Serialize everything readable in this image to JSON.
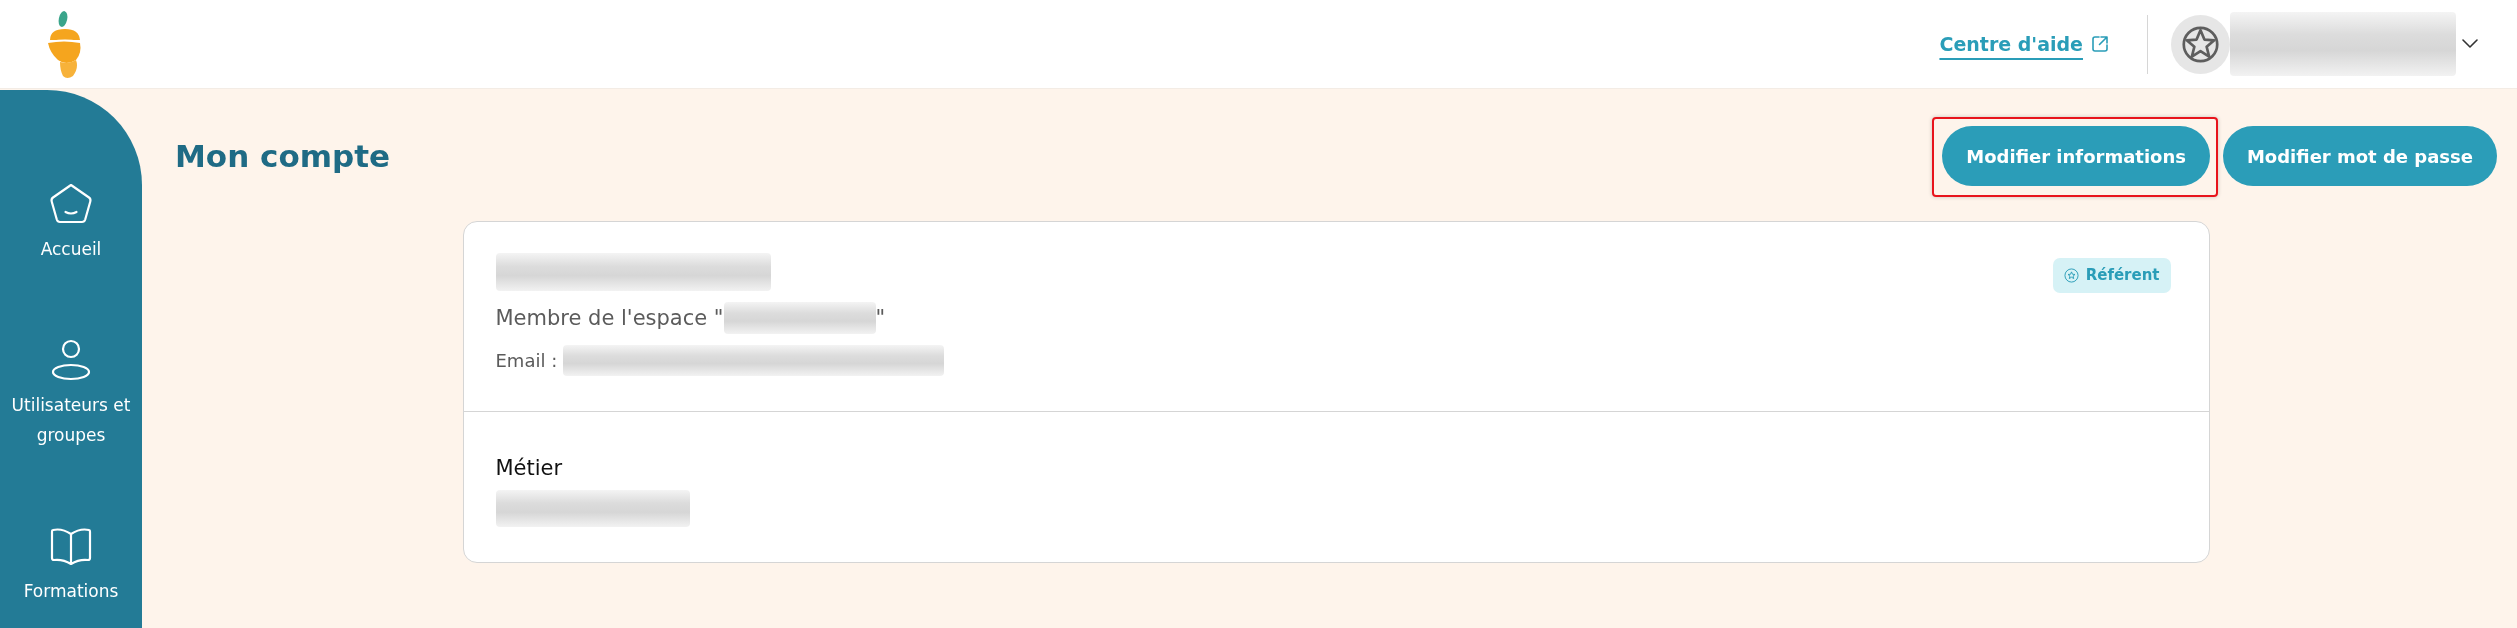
{
  "header": {
    "help_link": {
      "label": "Centre d'aide"
    },
    "user_menu": {
      "name_redacted": true,
      "expanded": false
    }
  },
  "sidebar": {
    "items": [
      {
        "kind": "home",
        "label": "Accueil"
      },
      {
        "kind": "users",
        "label": "Utilisateurs et groupes"
      },
      {
        "kind": "book",
        "label": "Formations"
      }
    ]
  },
  "page": {
    "title": "Mon compte",
    "buttons": [
      {
        "label": "Modifier informations",
        "highlighted": true
      },
      {
        "label": "Modifier mot de passe",
        "highlighted": false
      }
    ]
  },
  "profile_card": {
    "name_redacted": true,
    "badge": {
      "label": "Référent"
    },
    "membership": {
      "prefix": "Membre de l'espace \"",
      "space_redacted": true,
      "suffix": "\""
    },
    "email": {
      "label": "Email :",
      "value_redacted": true
    },
    "job": {
      "label": "Métier",
      "value_redacted": true
    }
  }
}
